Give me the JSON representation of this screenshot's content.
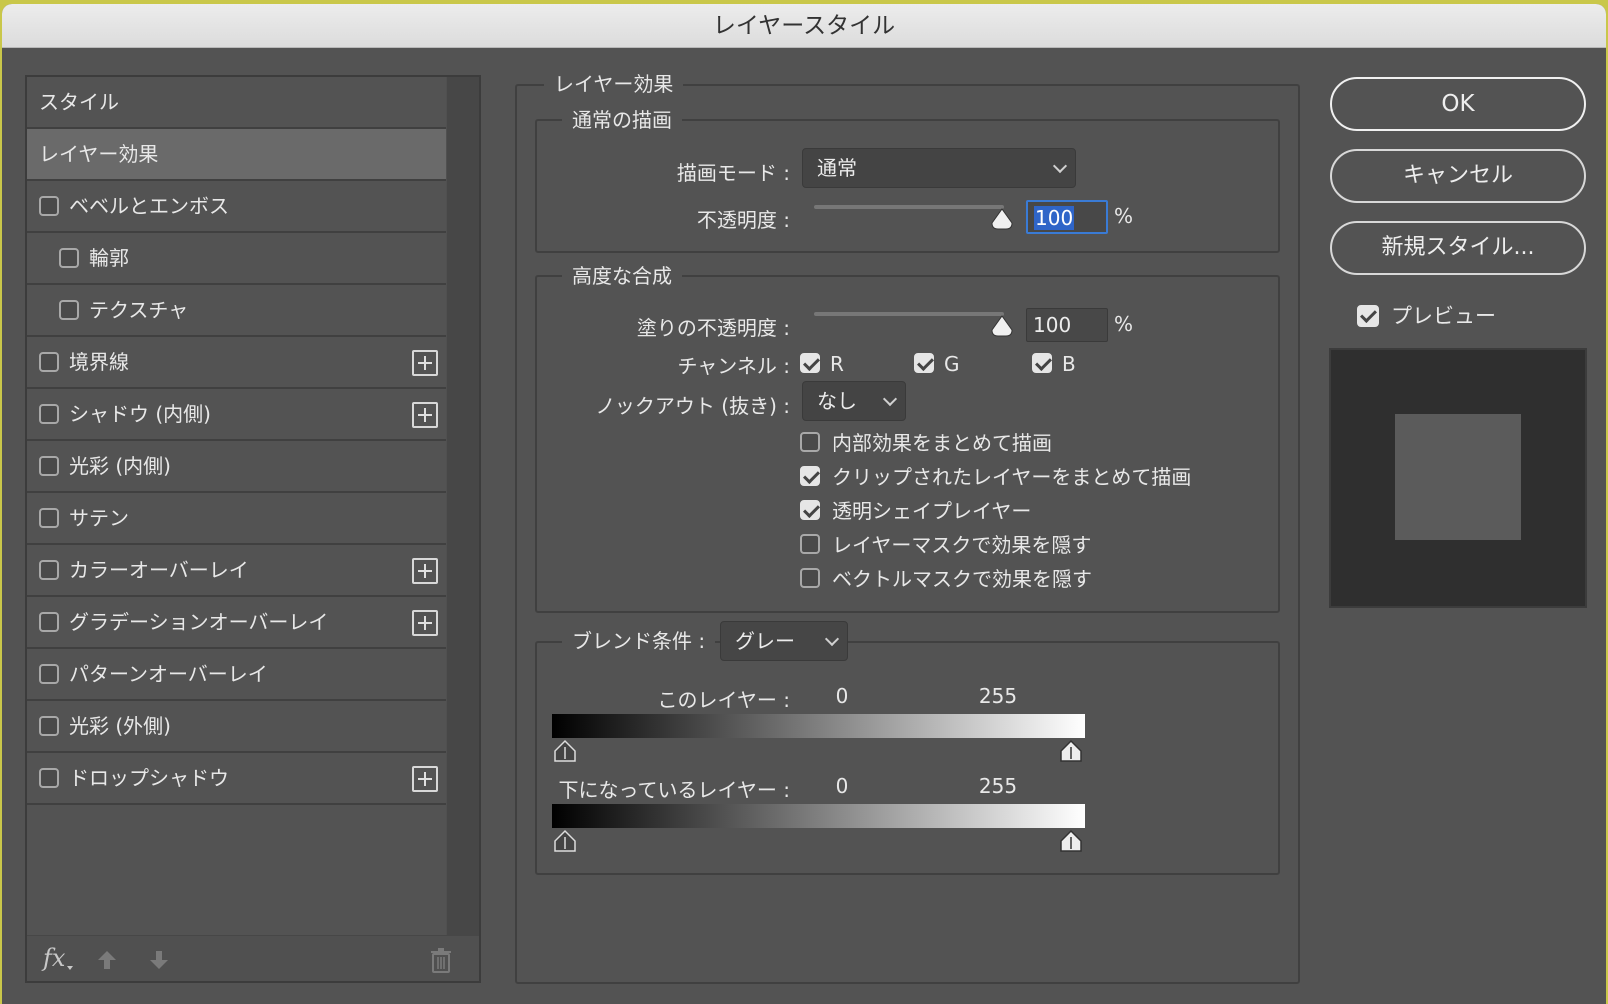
{
  "window": {
    "title": "レイヤースタイル"
  },
  "sidebar": {
    "items": [
      {
        "label": "スタイル",
        "type": "header"
      },
      {
        "label": "レイヤー効果",
        "type": "selected"
      },
      {
        "label": "ベベルとエンボス",
        "checked": false,
        "plus": false
      },
      {
        "label": "輪郭",
        "checked": false,
        "indent": true
      },
      {
        "label": "テクスチャ",
        "checked": false,
        "indent": true
      },
      {
        "label": "境界線",
        "checked": false,
        "plus": true
      },
      {
        "label": "シャドウ (内側)",
        "checked": false,
        "plus": true
      },
      {
        "label": "光彩 (内側)",
        "checked": false,
        "plus": false
      },
      {
        "label": "サテン",
        "checked": false,
        "plus": false
      },
      {
        "label": "カラーオーバーレイ",
        "checked": false,
        "plus": true
      },
      {
        "label": "グラデーションオーバーレイ",
        "checked": false,
        "plus": true
      },
      {
        "label": "パターンオーバーレイ",
        "checked": false,
        "plus": false
      },
      {
        "label": "光彩 (外側)",
        "checked": false,
        "plus": false
      },
      {
        "label": "ドロップシャドウ",
        "checked": false,
        "plus": true
      }
    ],
    "fx_label": "fx"
  },
  "main": {
    "section_title": "レイヤー効果",
    "normal": {
      "title": "通常の描画",
      "blend_mode_label": "描画モード :",
      "blend_mode_value": "通常",
      "opacity_label": "不透明度 :",
      "opacity_value": "100",
      "opacity_unit": "%"
    },
    "advanced": {
      "title": "高度な合成",
      "fill_opacity_label": "塗りの不透明度 :",
      "fill_opacity_value": "100",
      "fill_opacity_unit": "%",
      "channels_label": "チャンネル :",
      "channel_r": "R",
      "channel_g": "G",
      "channel_b": "B",
      "knockout_label": "ノックアウト (抜き) :",
      "knockout_value": "なし",
      "options": [
        {
          "label": "内部効果をまとめて描画",
          "checked": false
        },
        {
          "label": "クリップされたレイヤーをまとめて描画",
          "checked": true
        },
        {
          "label": "透明シェイプレイヤー",
          "checked": true
        },
        {
          "label": "レイヤーマスクで効果を隠す",
          "checked": false
        },
        {
          "label": "ベクトルマスクで効果を隠す",
          "checked": false
        }
      ]
    },
    "blend_if": {
      "title": "ブレンド条件 :",
      "value": "グレー",
      "this_layer_label": "このレイヤー :",
      "this_layer_min": "0",
      "this_layer_max": "255",
      "underlying_label": "下になっているレイヤー :",
      "underlying_min": "0",
      "underlying_max": "255"
    }
  },
  "buttons": {
    "ok": "OK",
    "cancel": "キャンセル",
    "new_style": "新規スタイル...",
    "preview_label": "プレビュー",
    "preview_checked": true
  },
  "colors": {
    "panel": "#535353",
    "accent": "#3a7bd5"
  }
}
